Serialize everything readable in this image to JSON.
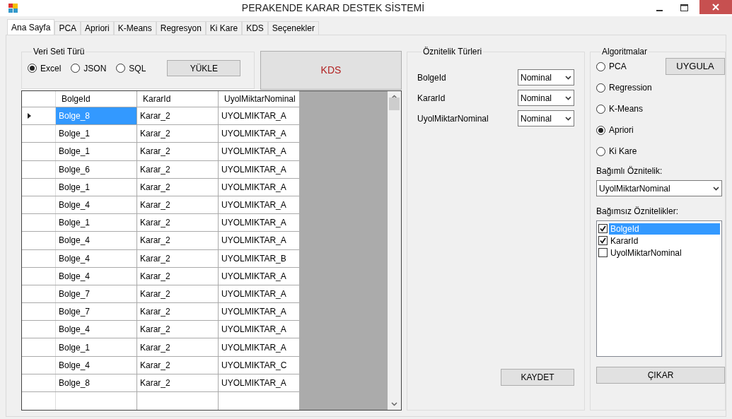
{
  "window": {
    "title": "PERAKENDE KARAR DESTEK SİSTEMİ"
  },
  "tabs": [
    {
      "label": "Ana Sayfa",
      "selected": true
    },
    {
      "label": "PCA",
      "selected": false
    },
    {
      "label": "Apriori",
      "selected": false
    },
    {
      "label": "K-Means",
      "selected": false
    },
    {
      "label": "Regresyon",
      "selected": false
    },
    {
      "label": "Ki Kare",
      "selected": false
    },
    {
      "label": "KDS",
      "selected": false
    },
    {
      "label": "Seçenekler",
      "selected": false
    }
  ],
  "dataset_group": {
    "title": "Veri Seti Türü",
    "options": [
      {
        "label": "Excel",
        "selected": true
      },
      {
        "label": "JSON",
        "selected": false
      },
      {
        "label": "SQL",
        "selected": false
      }
    ],
    "load_button": "YÜKLE"
  },
  "kds_button": "KDS",
  "grid": {
    "columns": [
      "BolgeId",
      "KararId",
      "UyolMiktarNominal"
    ],
    "rows": [
      {
        "current": true,
        "cells": [
          {
            "text": "Bolge_8",
            "selected": true
          },
          {
            "text": "Karar_2",
            "selected": false
          },
          {
            "text": "UYOLMIKTAR_A",
            "selected": false
          }
        ]
      },
      {
        "current": false,
        "cells": [
          {
            "text": "Bolge_1",
            "selected": false
          },
          {
            "text": "Karar_2",
            "selected": false
          },
          {
            "text": "UYOLMIKTAR_A",
            "selected": false
          }
        ]
      },
      {
        "current": false,
        "cells": [
          {
            "text": "Bolge_1",
            "selected": false
          },
          {
            "text": "Karar_2",
            "selected": false
          },
          {
            "text": "UYOLMIKTAR_A",
            "selected": false
          }
        ]
      },
      {
        "current": false,
        "cells": [
          {
            "text": "Bolge_6",
            "selected": false
          },
          {
            "text": "Karar_2",
            "selected": false
          },
          {
            "text": "UYOLMIKTAR_A",
            "selected": false
          }
        ]
      },
      {
        "current": false,
        "cells": [
          {
            "text": "Bolge_1",
            "selected": false
          },
          {
            "text": "Karar_2",
            "selected": false
          },
          {
            "text": "UYOLMIKTAR_A",
            "selected": false
          }
        ]
      },
      {
        "current": false,
        "cells": [
          {
            "text": "Bolge_4",
            "selected": false
          },
          {
            "text": "Karar_2",
            "selected": false
          },
          {
            "text": "UYOLMIKTAR_A",
            "selected": false
          }
        ]
      },
      {
        "current": false,
        "cells": [
          {
            "text": "Bolge_1",
            "selected": false
          },
          {
            "text": "Karar_2",
            "selected": false
          },
          {
            "text": "UYOLMIKTAR_A",
            "selected": false
          }
        ]
      },
      {
        "current": false,
        "cells": [
          {
            "text": "Bolge_4",
            "selected": false
          },
          {
            "text": "Karar_2",
            "selected": false
          },
          {
            "text": "UYOLMIKTAR_A",
            "selected": false
          }
        ]
      },
      {
        "current": false,
        "cells": [
          {
            "text": "Bolge_4",
            "selected": false
          },
          {
            "text": "Karar_2",
            "selected": false
          },
          {
            "text": "UYOLMIKTAR_B",
            "selected": false
          }
        ]
      },
      {
        "current": false,
        "cells": [
          {
            "text": "Bolge_4",
            "selected": false
          },
          {
            "text": "Karar_2",
            "selected": false
          },
          {
            "text": "UYOLMIKTAR_A",
            "selected": false
          }
        ]
      },
      {
        "current": false,
        "cells": [
          {
            "text": "Bolge_7",
            "selected": false
          },
          {
            "text": "Karar_2",
            "selected": false
          },
          {
            "text": "UYOLMIKTAR_A",
            "selected": false
          }
        ]
      },
      {
        "current": false,
        "cells": [
          {
            "text": "Bolge_7",
            "selected": false
          },
          {
            "text": "Karar_2",
            "selected": false
          },
          {
            "text": "UYOLMIKTAR_A",
            "selected": false
          }
        ]
      },
      {
        "current": false,
        "cells": [
          {
            "text": "Bolge_4",
            "selected": false
          },
          {
            "text": "Karar_2",
            "selected": false
          },
          {
            "text": "UYOLMIKTAR_A",
            "selected": false
          }
        ]
      },
      {
        "current": false,
        "cells": [
          {
            "text": "Bolge_1",
            "selected": false
          },
          {
            "text": "Karar_2",
            "selected": false
          },
          {
            "text": "UYOLMIKTAR_A",
            "selected": false
          }
        ]
      },
      {
        "current": false,
        "cells": [
          {
            "text": "Bolge_4",
            "selected": false
          },
          {
            "text": "Karar_2",
            "selected": false
          },
          {
            "text": "UYOLMIKTAR_C",
            "selected": false
          }
        ]
      },
      {
        "current": false,
        "cells": [
          {
            "text": "Bolge_8",
            "selected": false
          },
          {
            "text": "Karar_2",
            "selected": false
          },
          {
            "text": "UYOLMIKTAR_A",
            "selected": false
          }
        ]
      }
    ]
  },
  "attribute_types": {
    "title": "Öznitelik Türleri",
    "rows": [
      {
        "name": "BolgeId",
        "type": "Nominal"
      },
      {
        "name": "KararId",
        "type": "Nominal"
      },
      {
        "name": "UyolMiktarNominal",
        "type": "Nominal"
      }
    ],
    "save_button": "KAYDET"
  },
  "algorithms": {
    "title": "Algoritmalar",
    "options": [
      {
        "label": "PCA",
        "selected": false
      },
      {
        "label": "Regression",
        "selected": false
      },
      {
        "label": "K-Means",
        "selected": false
      },
      {
        "label": "Apriori",
        "selected": true
      },
      {
        "label": "Ki Kare",
        "selected": false
      }
    ],
    "apply_button": "UYGULA",
    "dependent": {
      "label": "Bağımlı Öznitelik:",
      "value": "UyolMiktarNominal"
    },
    "independent": {
      "label": "Bağımsız Öznitelikler:",
      "items": [
        {
          "label": "BolgeId",
          "checked": true,
          "selected": true
        },
        {
          "label": "KararId",
          "checked": true,
          "selected": false
        },
        {
          "label": "UyolMiktarNominal",
          "checked": false,
          "selected": false
        }
      ]
    },
    "remove_button": "ÇIKAR"
  }
}
